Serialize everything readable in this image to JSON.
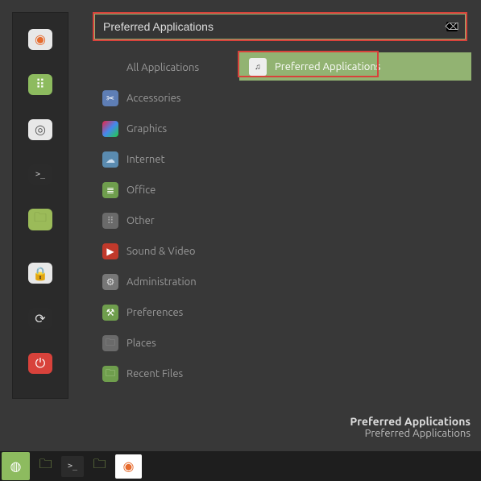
{
  "search": {
    "value": "Preferred Applications"
  },
  "dock": [
    {
      "name": "firefox-icon",
      "bg": "#e8e8e8",
      "fg": "#e66b2e",
      "glyph": "◉"
    },
    {
      "name": "messaging-icon",
      "bg": "#8dbb5f",
      "fg": "#fff",
      "glyph": "⠿"
    },
    {
      "name": "settings-icon",
      "bg": "#e8e8e8",
      "fg": "#555",
      "glyph": "◎"
    },
    {
      "name": "terminal-icon",
      "bg": "#2b2b2b",
      "fg": "#ccc",
      "glyph": ">_"
    },
    {
      "name": "files-icon",
      "bg": "#9bbb59",
      "fg": "#7a9444",
      "glyph": "🗀"
    },
    {
      "name": "lock-icon",
      "bg": "#e8e8e8",
      "fg": "#333",
      "glyph": "🔒"
    },
    {
      "name": "logout-icon",
      "bg": "#2b2b2b",
      "fg": "#ddd",
      "glyph": "⟳"
    },
    {
      "name": "power-icon",
      "bg": "#d8423b",
      "fg": "#fff",
      "glyph": "⏻"
    }
  ],
  "categories": [
    {
      "name": "all-applications",
      "label": "All Applications",
      "icon_bg": "transparent",
      "icon_fg": "#999",
      "glyph": ""
    },
    {
      "name": "accessories",
      "label": "Accessories",
      "icon_bg": "#5e7eb5",
      "icon_fg": "#fff",
      "glyph": "✂"
    },
    {
      "name": "graphics",
      "label": "Graphics",
      "icon_bg": "linear-gradient(135deg,#e24,#48e,#2c4)",
      "icon_fg": "#fff",
      "glyph": ""
    },
    {
      "name": "internet",
      "label": "Internet",
      "icon_bg": "#5a8bb0",
      "icon_fg": "#cde",
      "glyph": "☁"
    },
    {
      "name": "office",
      "label": "Office",
      "icon_bg": "#6f9e4d",
      "icon_fg": "#fff",
      "glyph": "≣"
    },
    {
      "name": "other",
      "label": "Other",
      "icon_bg": "#6a6a6a",
      "icon_fg": "#aaa",
      "glyph": "⠿"
    },
    {
      "name": "sound-video",
      "label": "Sound & Video",
      "icon_bg": "#c0392b",
      "icon_fg": "#fff",
      "glyph": "▶"
    },
    {
      "name": "administration",
      "label": "Administration",
      "icon_bg": "#777",
      "icon_fg": "#ddd",
      "glyph": "⚙"
    },
    {
      "name": "preferences",
      "label": "Preferences",
      "icon_bg": "#6f9e4d",
      "icon_fg": "#fff",
      "glyph": "⚒"
    },
    {
      "name": "places",
      "label": "Places",
      "icon_bg": "#6a6a6a",
      "icon_fg": "#999",
      "glyph": "🗀"
    },
    {
      "name": "recent-files",
      "label": "Recent Files",
      "icon_bg": "#6f9e4d",
      "icon_fg": "#c8dfb0",
      "glyph": "🗀"
    }
  ],
  "results": [
    {
      "name": "preferred-applications",
      "label": "Preferred Applications"
    }
  ],
  "tooltip": {
    "title": "Preferred Applications",
    "desc": "Preferred Applications"
  },
  "taskbar": [
    {
      "name": "menu-icon",
      "bg": "#8dbb5f",
      "fg": "#fff",
      "glyph": "◍"
    },
    {
      "name": "filemanager-icon",
      "bg": "transparent",
      "fg": "#9bbb59",
      "glyph": "🗀"
    },
    {
      "name": "terminal-icon",
      "bg": "#2b2b2b",
      "fg": "#ccc",
      "glyph": ">_"
    },
    {
      "name": "filemanager2-icon",
      "bg": "transparent",
      "fg": "#9bbb59",
      "glyph": "🗀"
    },
    {
      "name": "chrome-icon",
      "bg": "#fff",
      "fg": "#e66b2e",
      "glyph": "◉"
    }
  ]
}
